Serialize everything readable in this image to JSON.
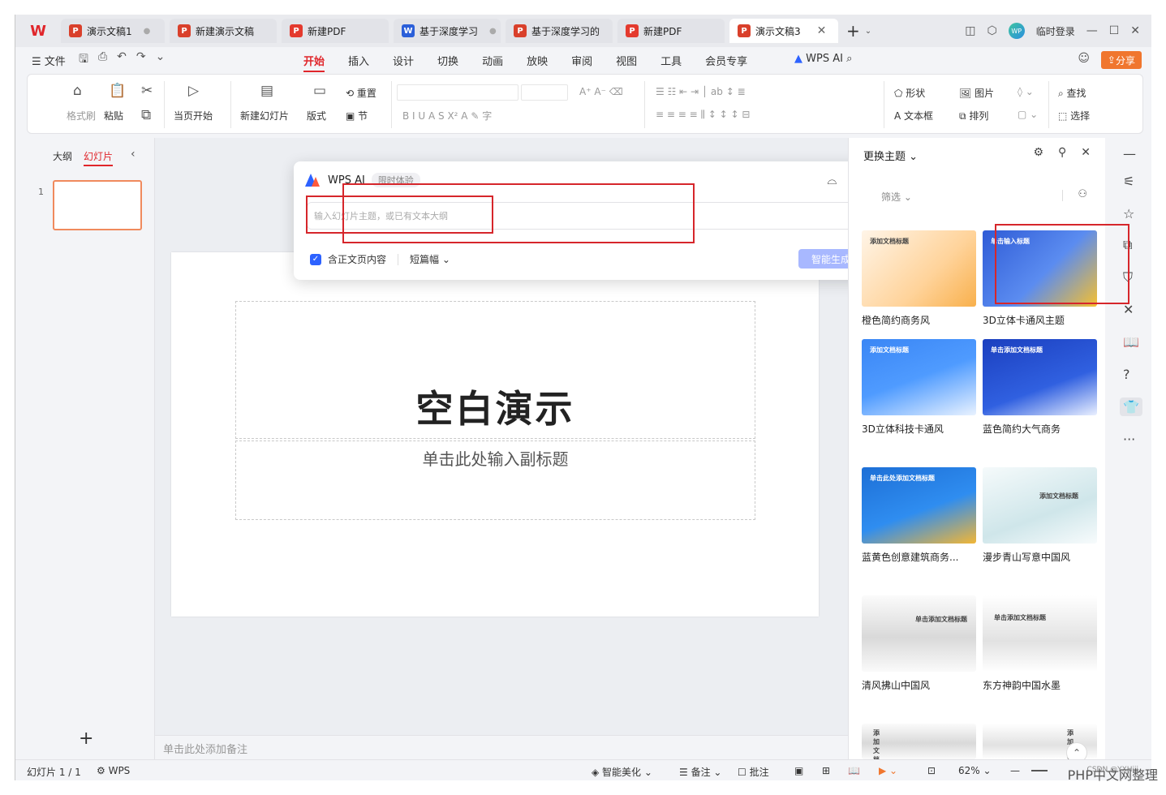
{
  "tabs": [
    {
      "label": "演示文稿1",
      "type": "P",
      "dot": "●"
    },
    {
      "label": "新建演示文稿",
      "type": "P"
    },
    {
      "label": "新建PDF",
      "type": "PDF"
    },
    {
      "label": "基于深度学习",
      "type": "W",
      "dot": "●"
    },
    {
      "label": "基于深度学习的",
      "type": "P"
    },
    {
      "label": "新建PDF",
      "type": "PDF"
    },
    {
      "label": "演示文稿3",
      "type": "P",
      "active": true
    }
  ],
  "tabbar": {
    "login": "临时登录",
    "avatar_text": "WP",
    "new_tab": "+"
  },
  "menubar": {
    "file": "文件",
    "menus": [
      "开始",
      "插入",
      "设计",
      "切换",
      "动画",
      "放映",
      "审阅",
      "视图",
      "工具",
      "会员专享"
    ],
    "active_menu": "开始",
    "wps_ai": "WPS AI",
    "share": "分享"
  },
  "ribbon": {
    "format_painter": "格式刷",
    "paste": "粘贴",
    "from_current": "当页开始",
    "new_slide": "新建幻灯片",
    "layout": "版式",
    "reset": "重置",
    "section": "节",
    "shape": "形状",
    "picture": "图片",
    "textbox": "文本框",
    "arrange": "排列",
    "find": "查找",
    "select": "选择"
  },
  "leftpane": {
    "outline_tab": "大纲",
    "slides_tab": "幻灯片",
    "slide_number": "1"
  },
  "slide": {
    "title": "空白演示",
    "subtitle": "单击此处输入副标题"
  },
  "notes": {
    "placeholder": "单击此处添加备注"
  },
  "ai_popup": {
    "title": "WPS AI",
    "badge": "限时体验",
    "input_placeholder": "输入幻灯片主题，或已有文本大纲",
    "include_page": "含正文页内容",
    "length": "短篇幅",
    "generate": "智能生成"
  },
  "theme_pane": {
    "title": "更换主题",
    "filter": "筛选",
    "themes": [
      {
        "name": "橙色简约商务风",
        "thumb_text": "添加文档标题"
      },
      {
        "name": "3D立体卡通风主题",
        "thumb_text": "单击输入标题"
      },
      {
        "name": "3D立体科技卡通风",
        "thumb_text": "添加文档标题"
      },
      {
        "name": "蓝色简约大气商务",
        "thumb_text": "单击添加文档标题"
      },
      {
        "name": "蓝黄色创意建筑商务...",
        "thumb_text": "单击此处添加文档标题"
      },
      {
        "name": "漫步青山写意中国风",
        "thumb_text": "添加文档标题"
      },
      {
        "name": "清风拂山中国风",
        "thumb_text": "单击添加文档标题"
      },
      {
        "name": "东方神韵中国水墨",
        "thumb_text": "单击添加文档标题"
      },
      {
        "name": "",
        "thumb_text": "添加文档标"
      },
      {
        "name": "",
        "thumb_text": "添加文档标题"
      }
    ]
  },
  "status": {
    "slide_count": "幻灯片 1 / 1",
    "wps": "WPS",
    "beautify": "智能美化",
    "notes": "备注",
    "comments": "批注",
    "zoom": "62%"
  },
  "watermark": {
    "site": "PHP中文网整理",
    "credit": "CSDN @YXHiii"
  }
}
